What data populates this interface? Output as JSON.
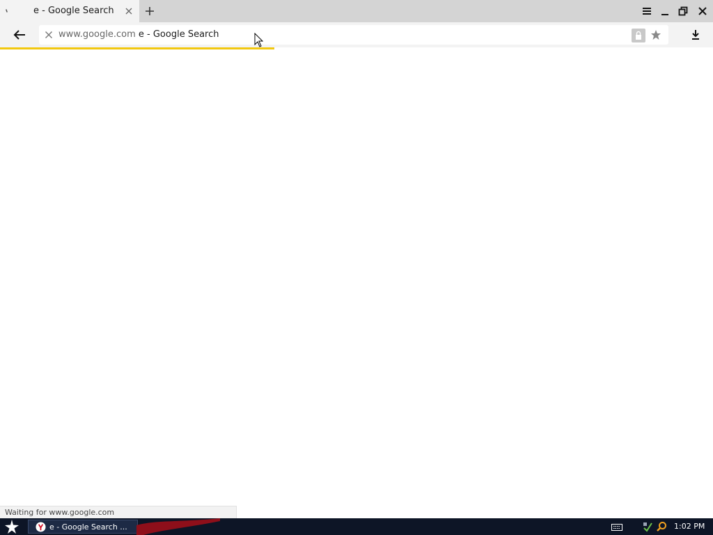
{
  "browser": {
    "tab": {
      "title": "e - Google Search"
    },
    "omnibox": {
      "domain": "www.google.com",
      "page_title": "e - Google Search"
    },
    "load_progress_percent": 38.5,
    "accent_color": "#f2c80f"
  },
  "status_bar": {
    "text": "Waiting for www.google.com"
  },
  "taskbar": {
    "window_label": "e - Google Search ...",
    "clock": "1:02 PM"
  },
  "icons": {
    "tab_spinner": "loading-spinner-icon",
    "tab_close": "close-icon",
    "new_tab": "plus-icon",
    "menu": "hamburger-menu-icon",
    "minimize": "minimize-icon",
    "restore": "restore-icon",
    "close_window": "close-icon",
    "back": "arrow-left-icon",
    "stop": "stop-icon",
    "lock": "lock-icon",
    "bookmark": "star-icon",
    "downloads": "download-icon",
    "start": "star-start-icon",
    "yandex": "yandex-browser-icon",
    "keyboard": "keyboard-icon",
    "network": "network-icon",
    "search": "search-icon"
  }
}
